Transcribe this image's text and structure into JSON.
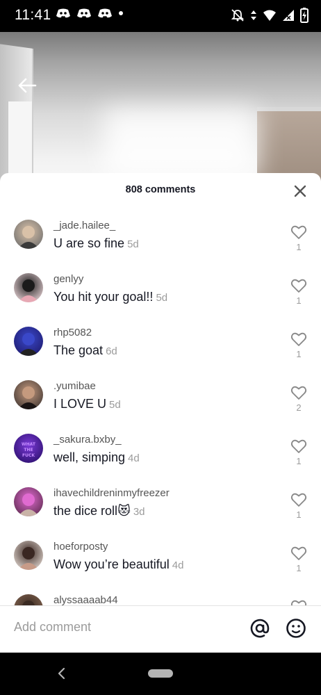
{
  "status_bar": {
    "time": "11:41",
    "notification_icons": [
      "discord-icon",
      "discord-icon",
      "discord-icon",
      "dot-icon"
    ],
    "system_icons": [
      "alarm-off-icon",
      "data-arrows-icon",
      "wifi-icon",
      "signal-icon",
      "battery-charging-icon"
    ]
  },
  "video": {
    "back_icon": "arrow-left-icon"
  },
  "sheet": {
    "title": "808 comments",
    "close_icon": "close-icon",
    "comments": [
      {
        "username": "_jade.hailee_",
        "text": "U are so fine",
        "age": "5d",
        "likes": "1",
        "avatar_colors": [
          "#6d6d6d",
          "#d9c1a8",
          "#3a3a3a"
        ]
      },
      {
        "username": "genlyy",
        "text": "You hit your goal!!",
        "age": "5d",
        "likes": "1",
        "avatar_colors": [
          "#f0dadd",
          "#1b1b1b",
          "#e7a8b4"
        ]
      },
      {
        "username": "rhp5082",
        "text": "The goat",
        "age": "6d",
        "likes": "1",
        "avatar_colors": [
          "#1e1a6d",
          "#3a48c9",
          "#222"
        ]
      },
      {
        "username": ".yumibae",
        "text": "I LOVE U",
        "age": "5d",
        "likes": "2",
        "avatar_colors": [
          "#3e3532",
          "#c59a7e",
          "#1a1414"
        ]
      },
      {
        "username": "_sakura.bxby_",
        "text": "well, simping",
        "age": "4d",
        "likes": "1",
        "avatar_colors": [
          "#2a0f6b",
          "#7a39d6",
          "#c58cff"
        ],
        "avatar_text": "WHAT THE FUCK"
      },
      {
        "username": "ihavechildreninmyfreezer",
        "text": "the dice roll",
        "emoji": "😻",
        "age": "3d",
        "likes": "1",
        "avatar_colors": [
          "#5b2a4d",
          "#e06bd0",
          "#c9b3a7"
        ]
      },
      {
        "username": "hoeforposty",
        "text": "Wow you’re beautiful",
        "age": "4d",
        "likes": "1",
        "avatar_colors": [
          "#e7ddd6",
          "#3a2722",
          "#c79b88"
        ]
      },
      {
        "username": "alyssaaaab44",
        "text": "",
        "age": "",
        "likes": "",
        "avatar_colors": [
          "#8a6a55",
          "#3a2a22",
          "#c9a38a"
        ]
      }
    ],
    "add_comment": {
      "placeholder": "Add comment",
      "value": "",
      "mention_icon": "at-icon",
      "emoji_icon": "emoji-icon"
    }
  },
  "nav_bar": {
    "back_icon": "nav-back-icon",
    "home_icon": "nav-home-pill"
  },
  "colors": {
    "text": "#161823",
    "secondary": "#9b9b9b",
    "divider": "#e3e3e3"
  }
}
